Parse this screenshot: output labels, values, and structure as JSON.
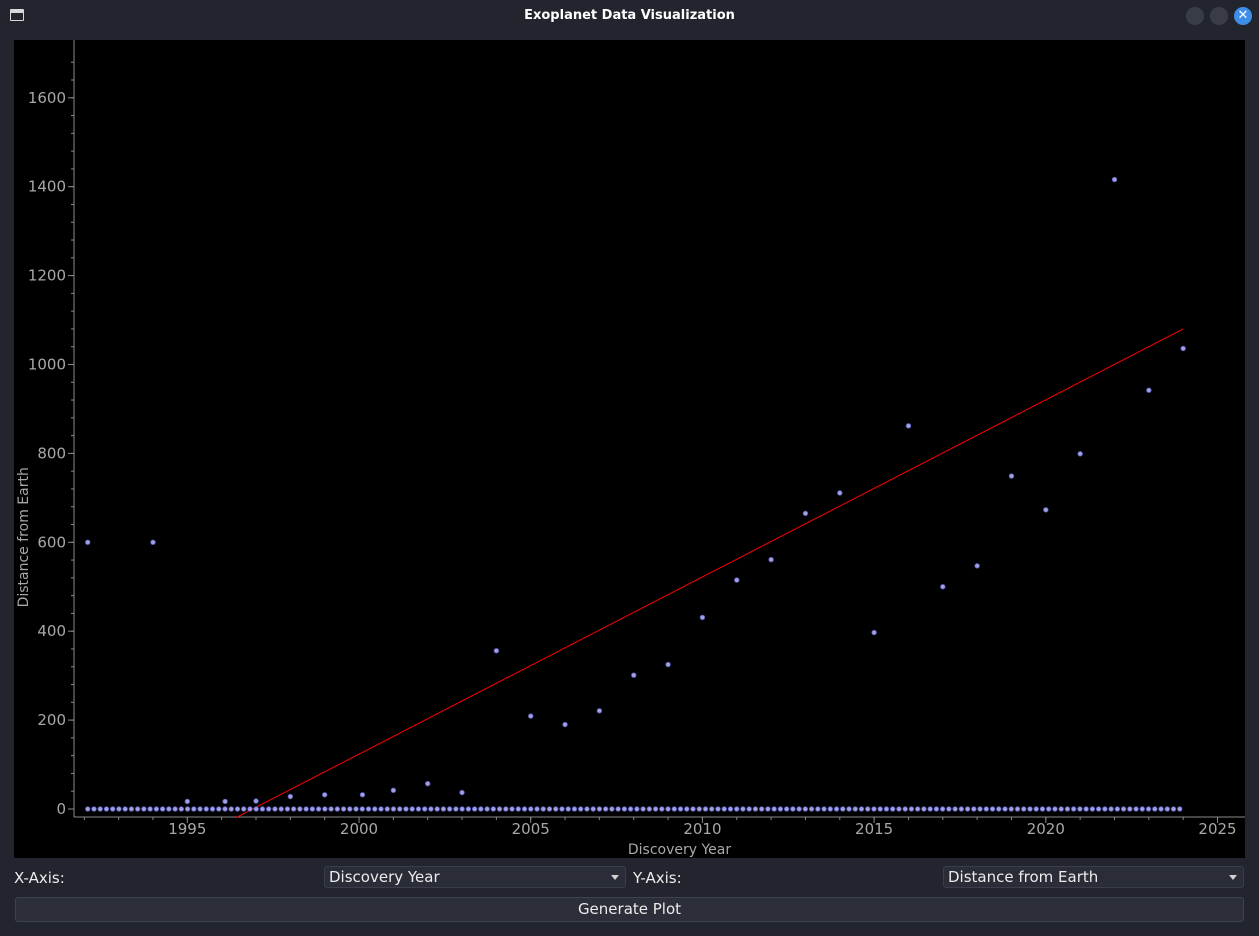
{
  "window": {
    "title": "Exoplanet Data Visualization"
  },
  "controls": {
    "x_axis_label": "X-Axis:",
    "x_axis_value": "Discovery Year",
    "y_axis_label": "Y-Axis:",
    "y_axis_value": "Distance from Earth",
    "generate_button": "Generate Plot"
  },
  "colors": {
    "background": "#000000",
    "point_fill": "#a0a0e8",
    "trend_line": "#ff0000",
    "axis": "#888888"
  },
  "chart_data": {
    "type": "scatter",
    "xlabel": "Discovery Year",
    "ylabel": "Distance from Earth",
    "xlim": [
      1991.7,
      2025.8
    ],
    "ylim": [
      -18,
      1730
    ],
    "xticks": [
      1995,
      2000,
      2005,
      2010,
      2015,
      2020,
      2025
    ],
    "yticks": [
      0,
      200,
      400,
      600,
      800,
      1000,
      1200,
      1400,
      1600
    ],
    "grid": false,
    "points_nonzero": [
      {
        "x": 1992.1,
        "y": 600
      },
      {
        "x": 1994.0,
        "y": 600
      },
      {
        "x": 1995.0,
        "y": 17
      },
      {
        "x": 1996.1,
        "y": 17
      },
      {
        "x": 1997.0,
        "y": 18
      },
      {
        "x": 1998.0,
        "y": 28
      },
      {
        "x": 1999.0,
        "y": 32
      },
      {
        "x": 2000.1,
        "y": 32
      },
      {
        "x": 2001.0,
        "y": 42
      },
      {
        "x": 2002.0,
        "y": 57
      },
      {
        "x": 2003.0,
        "y": 37
      },
      {
        "x": 2004.0,
        "y": 356
      },
      {
        "x": 2005.0,
        "y": 209
      },
      {
        "x": 2006.0,
        "y": 190
      },
      {
        "x": 2007.0,
        "y": 221
      },
      {
        "x": 2008.0,
        "y": 301
      },
      {
        "x": 2009.0,
        "y": 325
      },
      {
        "x": 2010.0,
        "y": 431
      },
      {
        "x": 2011.0,
        "y": 515
      },
      {
        "x": 2012.0,
        "y": 561
      },
      {
        "x": 2013.0,
        "y": 665
      },
      {
        "x": 2014.0,
        "y": 711
      },
      {
        "x": 2015.0,
        "y": 397
      },
      {
        "x": 2016.0,
        "y": 862
      },
      {
        "x": 2017.0,
        "y": 500
      },
      {
        "x": 2018.0,
        "y": 547
      },
      {
        "x": 2019.0,
        "y": 749
      },
      {
        "x": 2020.0,
        "y": 673
      },
      {
        "x": 2021.0,
        "y": 799
      },
      {
        "x": 2022.0,
        "y": 1416
      },
      {
        "x": 2023.0,
        "y": 942
      },
      {
        "x": 2024.0,
        "y": 1036
      }
    ],
    "zero_series_x_range": [
      1992.1,
      2023.9
    ],
    "zero_series_count": 176,
    "zero_series_y": 0,
    "trend_line": {
      "x": [
        1996.4,
        2024.0
      ],
      "y": [
        -20,
        1080
      ]
    }
  }
}
